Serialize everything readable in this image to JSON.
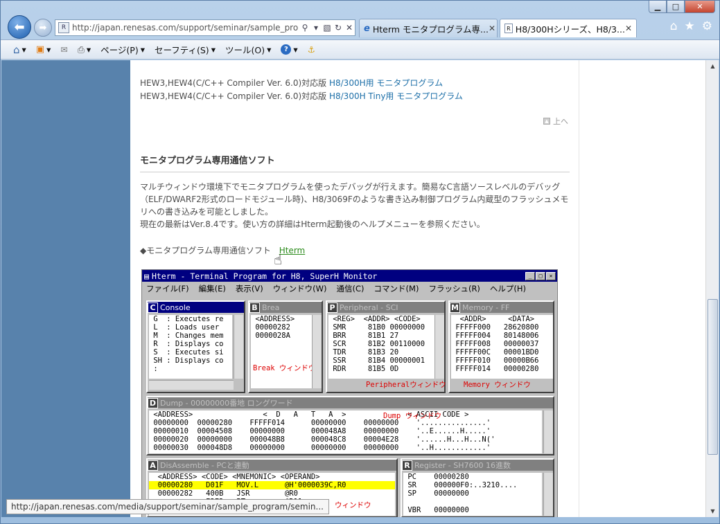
{
  "browser": {
    "address_url": "http://japan.renesas.com/support/seminar/sample_pro",
    "tabs": [
      {
        "label": "Hterm モニタプログラム専...",
        "close": "✕"
      },
      {
        "label": "H8/300Hシリーズ、H8/3...",
        "close": "✕"
      }
    ],
    "commands": [
      {
        "label": "ページ(P)"
      },
      {
        "label": "セーフティ(S)"
      },
      {
        "label": "ツール(O)"
      }
    ],
    "status_url": "http://japan.renesas.com/media/support/seminar/sample_program/semin..."
  },
  "page": {
    "line1_prefix": "HEW3,HEW4(C/C++ Compiler Ver. 6.0)対応版",
    "line1_link": "H8/300H用 モニタプログラム",
    "line2_prefix": "HEW3,HEW4(C/C++ Compiler Ver. 6.0)対応版",
    "line2_link": "H8/300H Tiny用 モニタプログラム",
    "top_link": "上へ",
    "heading": "モニタプログラム専用通信ソフト",
    "para1": "マルチウィンドウ環境下でモニタプログラムを使ったデバッグが行えます。簡易なC言語ソースレベルのデバッグ（ELF/DWARF2形式のロードモジュール時)、H8/3069Fのような書き込み制御プログラム内蔵型のフラッシュメモリへの書き込みを可能としました。",
    "para2": "現在の最新はVer.8.4です。使い方の詳細はHterm起動後のヘルプメニューを参照ください。",
    "hterm_prefix": "◆モニタプログラム専用通信ソフト",
    "hterm_link": "Hterm"
  },
  "hterm": {
    "title": "Hterm - Terminal Program for H8, SuperH Monitor",
    "menus": [
      "ファイル(F)",
      "編集(E)",
      "表示(V)",
      "ウィンドウ(W)",
      "通信(C)",
      "コマンド(M)",
      "フラッシュ(R)",
      "ヘルプ(H)"
    ],
    "console": {
      "letter": "C",
      "title": "Console",
      "text": " G  : Executes re\n L  : Loads user \n M  : Changes mem\n R  : Displays co\n S  : Executes si\n SH : Displays co\n :"
    },
    "break": {
      "letter": "B",
      "title": "Brea",
      "text": " <ADDRESS>\n 00000282\n 0000028A",
      "label": "Break ウィンドウ"
    },
    "peripheral": {
      "letter": "P",
      "title": "Peripheral - SCI",
      "text": " <REG>  <ADDR> <CODE>\n SMR     81B0 00000000\n BRR     81B1 27\n SCR     81B2 00110000\n TDR     81B3 20\n SSR     81B4 00000001\n RDR     81B5 0D",
      "label": "Peripheralウィンドウ"
    },
    "memory": {
      "letter": "M",
      "title": "Memory - FF",
      "text": "  <ADDR>     <DATA>\n FFFFF000   28620800\n FFFFF004   80148006\n FFFFF008   00000037\n FFFFF00C   00001BD0\n FFFFF010   00000B66\n FFFFF014   00000280",
      "label": "Memory ウィンドウ"
    },
    "dump": {
      "letter": "D",
      "title": "Dump - 00000000番地 ロングワード",
      "text": " <ADDRESS>                <  D   A   T   A  >              < ASCII CODE >\n 00000000  00000280    FFFFF014      00000000    00000000    '...............'\n 00000010  00004508    00000000      000048A8    00000000    '..E......H.....'\n 00000020  00000000    000048B8      000048C8    00004E28    '......H...H...N('\n 00000030  000048D8    00000000      00000000    00000000    '..H............'",
      "label": "Dump ウィンドウ"
    },
    "disasm": {
      "letter": "A",
      "title": "DisAssemble - PCと連動",
      "header": "  <ADDRESS> <CODE> <MNEMONIC> <OPERAND>",
      "row1": "  00000280   D01F   MOV.L      @H'0000039C,R0",
      "row2": "  00000282   400B   JSR        @R0",
      "row3": "             E2E2   BT         @R11",
      "label": "ウィンドウ"
    },
    "register": {
      "letter": "R",
      "title": "Register - SH7600 16進数",
      "text": " PC    00000280\n SR    000000F0:..3210....\n SP    00000000\n\n VBR   00000000"
    }
  }
}
